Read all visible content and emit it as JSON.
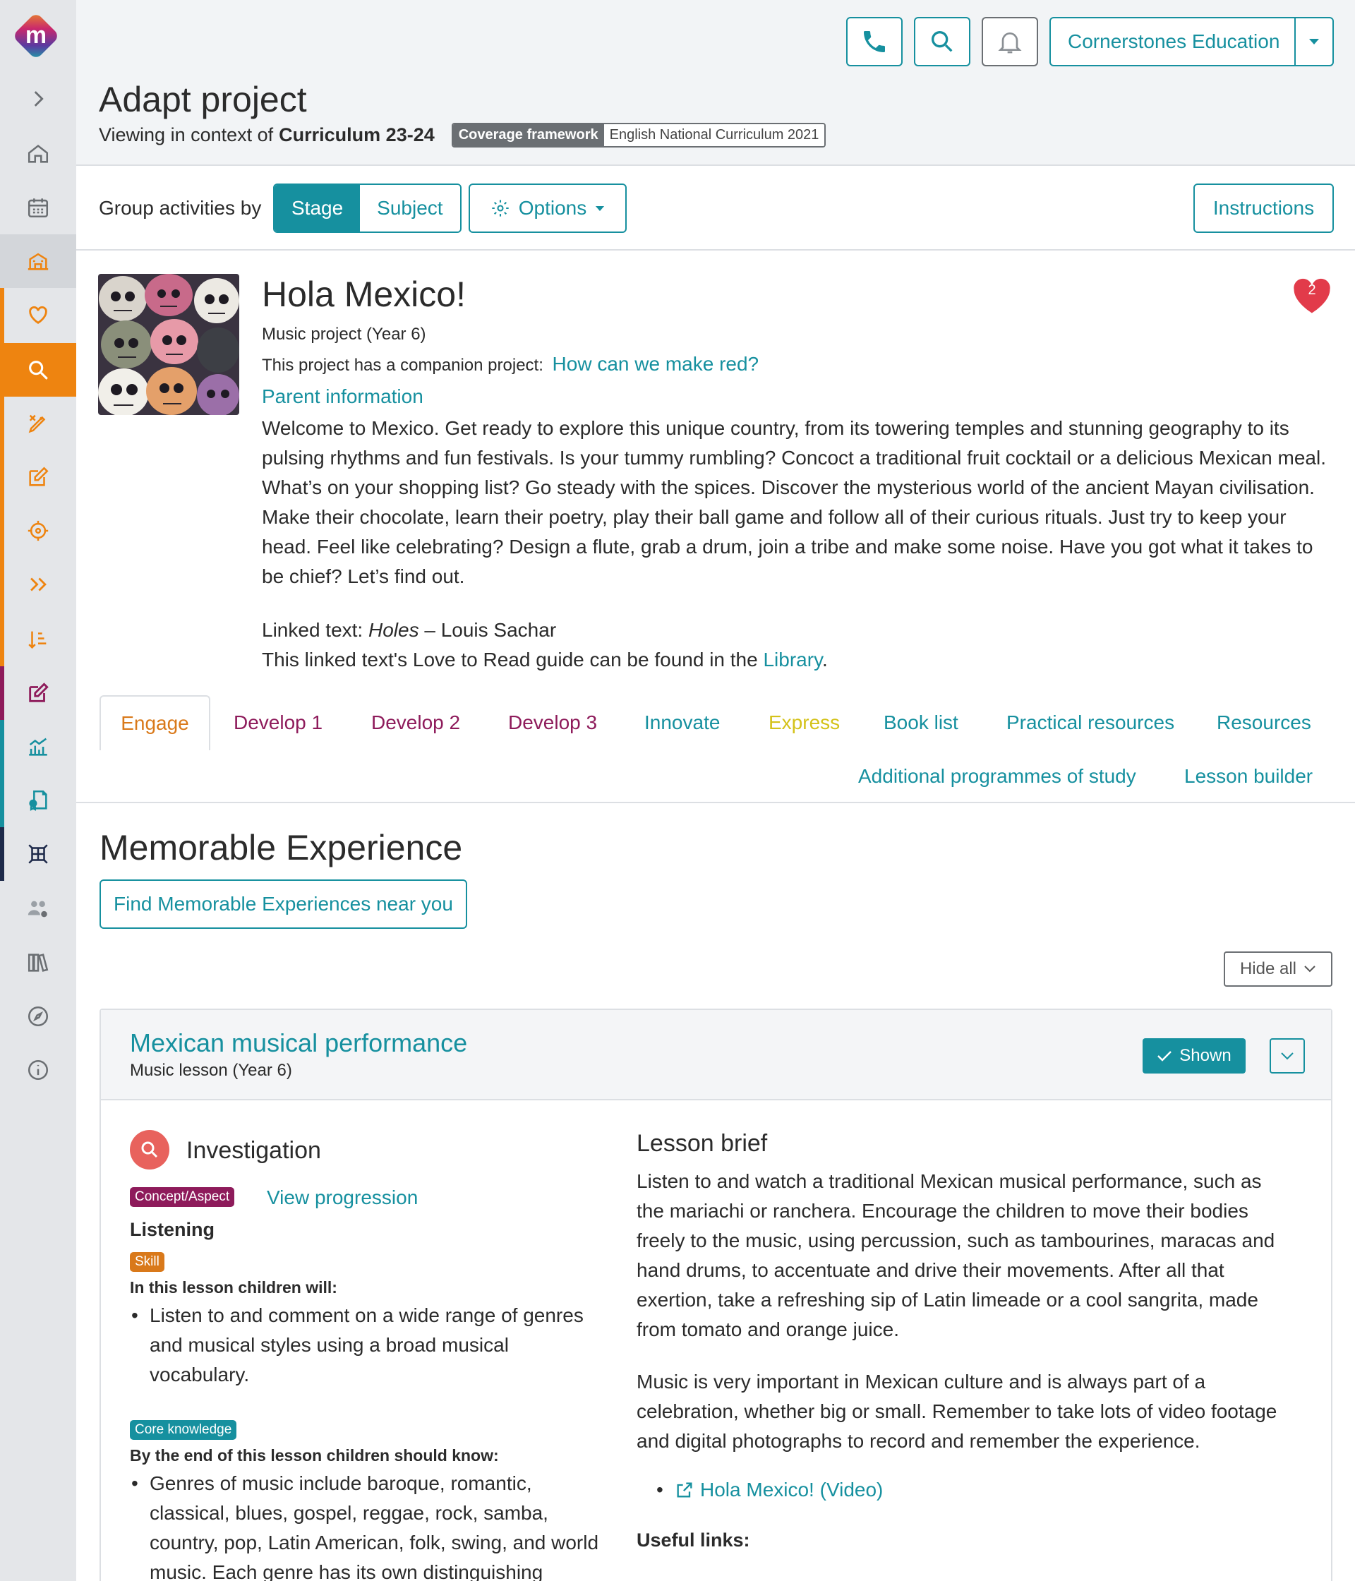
{
  "header": {
    "org_name": "Cornerstones Education",
    "page_title": "Adapt project",
    "context_prefix": "Viewing in context of",
    "context_name": "Curriculum 23-24",
    "coverage_key": "Coverage framework",
    "coverage_value": "English National Curriculum 2021"
  },
  "toolbar": {
    "group_label": "Group activities by",
    "stage_label": "Stage",
    "subject_label": "Subject",
    "options_label": "Options",
    "instructions_label": "Instructions"
  },
  "project": {
    "title": "Hola Mexico!",
    "subtitle": "Music project (Year 6)",
    "companion_prefix": "This project has a companion project:",
    "companion_link": "How can we make red?",
    "parent_info": "Parent information",
    "description": "Welcome to Mexico. Get ready to explore this unique country, from its towering temples and stunning geography to its pulsing rhythms and fun festivals. Is your tummy rumbling? Concoct a traditional fruit cocktail or a delicious Mexican meal. What’s on your shopping list? Go steady with the spices. Discover the mysterious world of the ancient Mayan civilisation. Make their chocolate, learn their poetry, play their ball game and follow all of their curious rituals. Just try to keep your head. Feel like celebrating? Design a flute, grab a drum, join a tribe and make some noise. Have you got what it takes to be chief? Let’s find out.",
    "linked_prefix": "Linked text:",
    "linked_title": "Holes",
    "linked_author": "– Louis Sachar",
    "guide_prefix": "This linked text's Love to Read guide can be found in the",
    "guide_link": "Library",
    "guide_suffix": ".",
    "favourite_count": "2"
  },
  "tabs": [
    {
      "label": "Engage",
      "color": "#d9791a"
    },
    {
      "label": "Develop 1",
      "color": "#8e1b5b"
    },
    {
      "label": "Develop 2",
      "color": "#8e1b5b"
    },
    {
      "label": "Develop 3",
      "color": "#8e1b5b"
    },
    {
      "label": "Innovate",
      "color": "#16909f"
    },
    {
      "label": "Express",
      "color": "#d4c21a"
    },
    {
      "label": "Book list",
      "color": "#16909f"
    },
    {
      "label": "Practical resources",
      "color": "#16909f"
    },
    {
      "label": "Resources",
      "color": "#16909f"
    },
    {
      "label": "Additional programmes of study",
      "color": "#16909f"
    },
    {
      "label": "Lesson builder",
      "color": "#16909f"
    }
  ],
  "memorable": {
    "title": "Memorable Experience",
    "find_button": "Find Memorable Experiences near you",
    "hide_all": "Hide all"
  },
  "lesson": {
    "title": "Mexican musical performance",
    "subtitle": "Music lesson (Year 6)",
    "shown_label": "Shown",
    "type_label": "Investigation",
    "concept_tag": "Concept/Aspect",
    "view_progression": "View progression",
    "concept_value": "Listening",
    "skill_tag": "Skill",
    "will_heading": "In this lesson children will:",
    "will_items": [
      "Listen to and comment on a wide range of genres and musical styles using a broad musical vocabulary."
    ],
    "core_tag": "Core knowledge",
    "know_heading": "By the end of this lesson children should know:",
    "know_items": [
      "Genres of music include baroque, romantic, classical, blues, gospel, reggae, rock, samba, country, pop, Latin American, folk, swing, and world music. Each genre has its own distinguishing"
    ],
    "brief_title": "Lesson brief",
    "brief_p1": "Listen to and watch a traditional Mexican musical performance, such as the mariachi or ranchera. Encourage the children to move their bodies freely to the music, using percussion, such as tambourines, maracas and hand drums, to accentuate and drive their movements. After all that exertion, take a refreshing sip of Latin limeade or a cool sangrita, made from tomato and orange juice.",
    "brief_p2": "Music is very important in Mexican culture and is always part of a celebration, whether big or small. Remember to take lots of video footage and digital photographs to record and remember the experience.",
    "video_link": "Hola Mexico! (Video)",
    "useful_links": "Useful links:"
  },
  "colors": {
    "accent": "#16909f",
    "engage": "#d9791a",
    "develop": "#8e1b5b",
    "express": "#d4c21a",
    "favourite": "#e23b4a",
    "sidebar_active": "#ee8410"
  }
}
